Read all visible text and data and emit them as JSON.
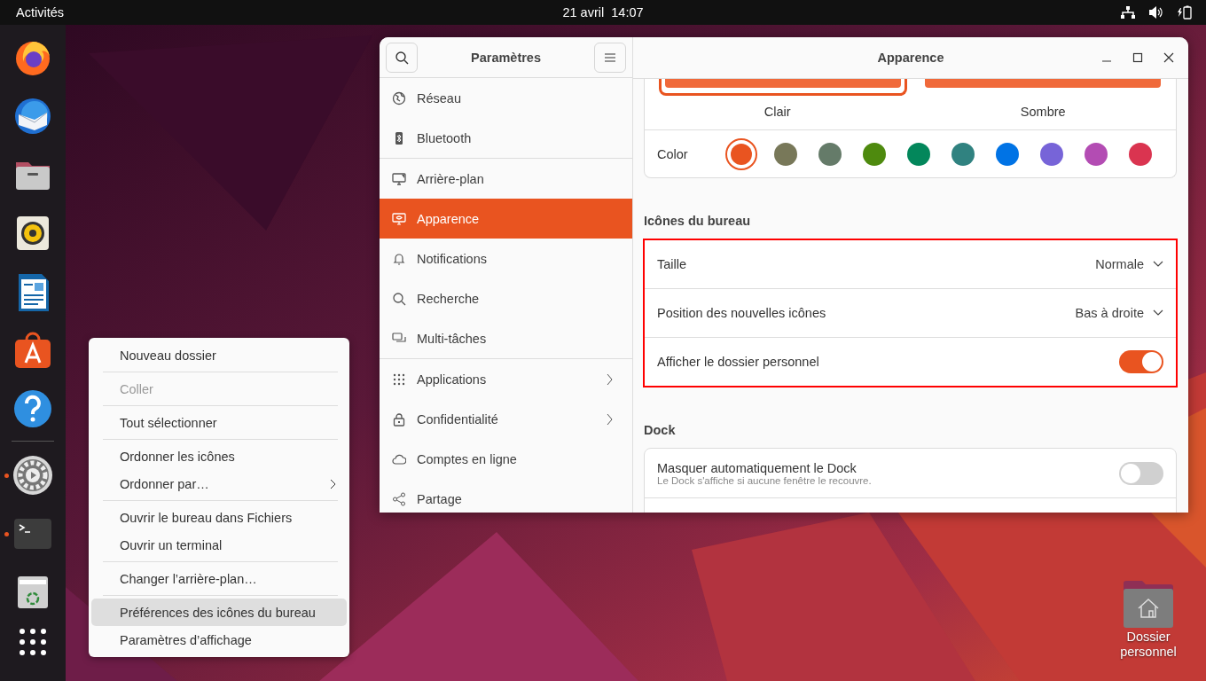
{
  "top_bar": {
    "activities": "Activités",
    "clock": "21 avril  14:07"
  },
  "dock": {
    "items": [
      {
        "running": false
      },
      {
        "running": false
      },
      {
        "running": false
      },
      {
        "running": false
      },
      {
        "running": false
      },
      {
        "running": false
      },
      {
        "running": false
      },
      {
        "running": true
      },
      {
        "running": true
      },
      {
        "running": false
      }
    ]
  },
  "settings": {
    "sidebar_title": "Paramètres",
    "title": "Apparence",
    "sidebar_groups": [
      [
        {
          "label": "Réseau",
          "selected": false,
          "submenu": false
        },
        {
          "label": "Bluetooth",
          "selected": false,
          "submenu": false
        }
      ],
      [
        {
          "label": "Arrière-plan",
          "selected": false,
          "submenu": false
        },
        {
          "label": "Apparence",
          "selected": true,
          "submenu": false
        },
        {
          "label": "Notifications",
          "selected": false,
          "submenu": false
        },
        {
          "label": "Recherche",
          "selected": false,
          "submenu": false
        },
        {
          "label": "Multi-tâches",
          "selected": false,
          "submenu": false
        }
      ],
      [
        {
          "label": "Applications",
          "selected": false,
          "submenu": true
        },
        {
          "label": "Confidentialité",
          "selected": false,
          "submenu": true
        },
        {
          "label": "Comptes en ligne",
          "selected": false,
          "submenu": false
        },
        {
          "label": "Partage",
          "selected": false,
          "submenu": false
        }
      ]
    ],
    "themes": [
      {
        "label": "Clair",
        "selected": true
      },
      {
        "label": "Sombre",
        "selected": false
      }
    ],
    "color_label": "Color",
    "colors": [
      {
        "color": "#e95420",
        "selected": true
      },
      {
        "color": "#787859",
        "selected": false
      },
      {
        "color": "#657b69",
        "selected": false
      },
      {
        "color": "#4e8a0e",
        "selected": false
      },
      {
        "color": "#03875b",
        "selected": false
      },
      {
        "color": "#308280",
        "selected": false
      },
      {
        "color": "#0073e5",
        "selected": false
      },
      {
        "color": "#7764d8",
        "selected": false
      },
      {
        "color": "#b34cb3",
        "selected": false
      },
      {
        "color": "#da3450",
        "selected": false
      }
    ],
    "sections": [
      {
        "heading": "Icônes du bureau",
        "highlighted": true,
        "rows": [
          {
            "kind": "dropdown",
            "label": "Taille",
            "value": "Normale"
          },
          {
            "kind": "dropdown",
            "label": "Position des nouvelles icônes",
            "value": "Bas à droite"
          },
          {
            "kind": "toggle",
            "label": "Afficher le dossier personnel",
            "on": true
          }
        ]
      },
      {
        "heading": "Dock",
        "highlighted": false,
        "rows": [
          {
            "kind": "toggle",
            "label": "Masquer automatiquement le Dock",
            "subtitle": "Le Dock s'affiche si aucune fenêtre le recouvre.",
            "on": false
          }
        ]
      }
    ]
  },
  "context_menu": {
    "groups": [
      [
        {
          "label": "Nouveau dossier",
          "disabled": false,
          "highlighted": false,
          "submenu": false
        }
      ],
      [
        {
          "label": "Coller",
          "disabled": true,
          "highlighted": false,
          "submenu": false
        }
      ],
      [
        {
          "label": "Tout sélectionner",
          "disabled": false,
          "highlighted": false,
          "submenu": false
        }
      ],
      [
        {
          "label": "Ordonner les icônes",
          "disabled": false,
          "highlighted": false,
          "submenu": false
        },
        {
          "label": "Ordonner par…",
          "disabled": false,
          "highlighted": false,
          "submenu": true
        }
      ],
      [
        {
          "label": "Ouvrir le bureau dans Fichiers",
          "disabled": false,
          "highlighted": false,
          "submenu": false
        },
        {
          "label": "Ouvrir un terminal",
          "disabled": false,
          "highlighted": false,
          "submenu": false
        }
      ],
      [
        {
          "label": "Changer l’arrière-plan…",
          "disabled": false,
          "highlighted": false,
          "submenu": false
        }
      ],
      [
        {
          "label": "Préférences des icônes du bureau",
          "disabled": false,
          "highlighted": true,
          "submenu": false
        },
        {
          "label": "Paramètres d’affichage",
          "disabled": false,
          "highlighted": false,
          "submenu": false
        }
      ]
    ]
  },
  "desktop_icons": [
    {
      "label": "Dossier personnel"
    }
  ]
}
